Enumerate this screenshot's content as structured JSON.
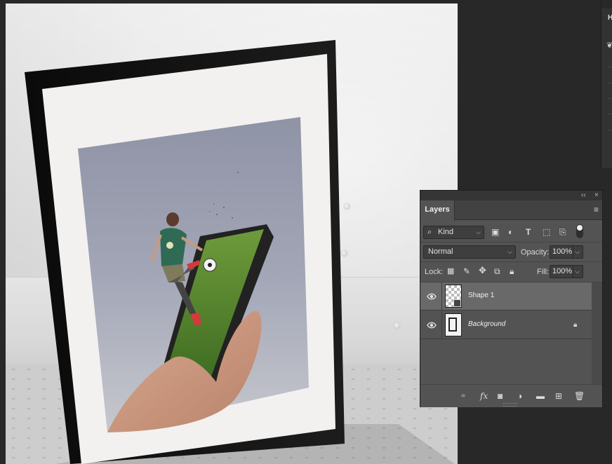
{
  "document": {
    "description_tag": "canvas"
  },
  "side_panel": {
    "tab_label": "H"
  },
  "layers_panel": {
    "title": "Layers",
    "collapse_glyph": "‹‹",
    "close_glyph": "×",
    "filter": {
      "value": "Kind"
    },
    "blend_mode": {
      "value": "Normal"
    },
    "opacity": {
      "label": "Opacity:",
      "value": "100%"
    },
    "lock": {
      "label": "Lock:"
    },
    "fill": {
      "label": "Fill:",
      "value": "100%"
    },
    "layers": [
      {
        "name": "Shape 1",
        "visible": true,
        "selected": true,
        "locked": false
      },
      {
        "name": "Background",
        "visible": true,
        "selected": false,
        "locked": true
      }
    ],
    "footer_fx": "fx"
  },
  "colors": {
    "workspace": "#282828",
    "panel": "#535353",
    "selected_row": "#696969",
    "frame": "#111111"
  }
}
